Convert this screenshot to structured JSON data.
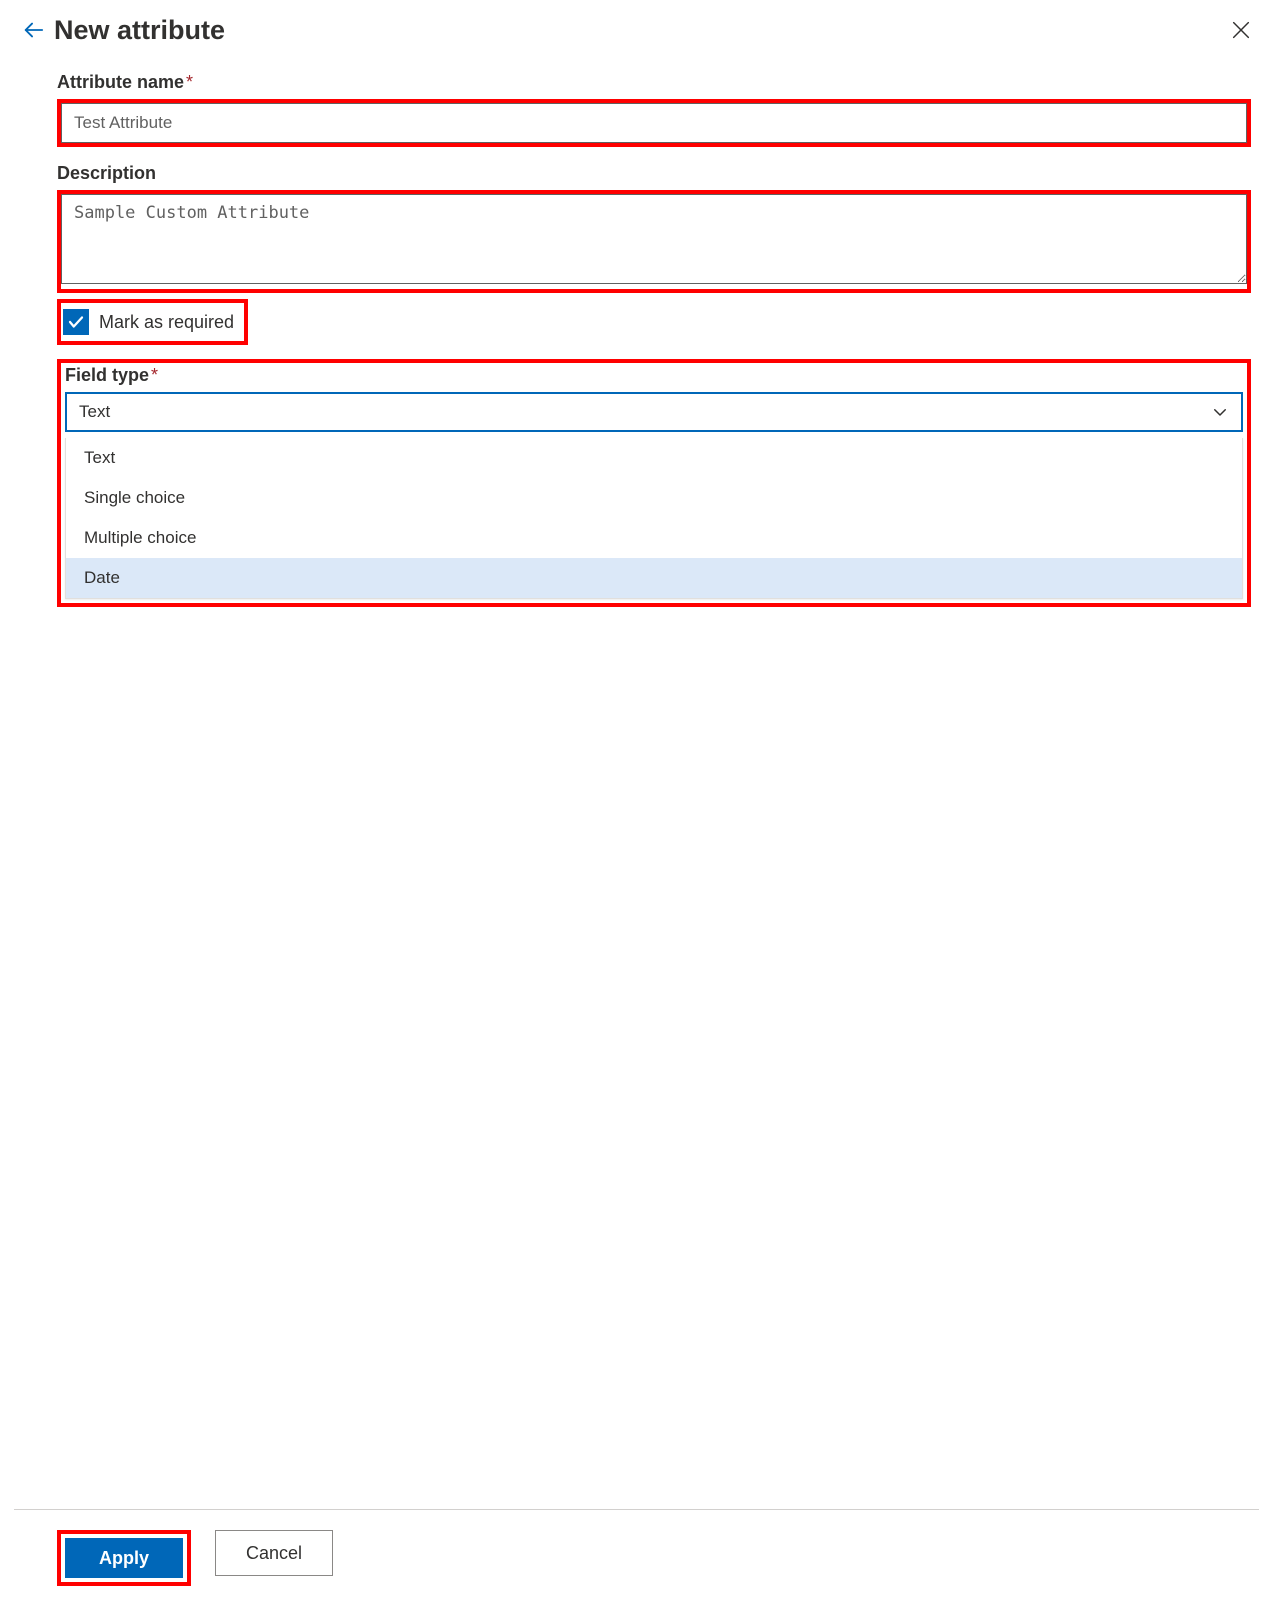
{
  "header": {
    "title": "New attribute"
  },
  "attribute_name": {
    "label": "Attribute name",
    "value": "Test Attribute"
  },
  "description": {
    "label": "Description",
    "value": "Sample Custom Attribute"
  },
  "mark_required": {
    "label": "Mark as required",
    "checked": true
  },
  "field_type": {
    "label": "Field type",
    "selected": "Text",
    "options": [
      "Text",
      "Single choice",
      "Multiple choice",
      "Date"
    ],
    "hovered_option": "Date"
  },
  "buttons": {
    "apply": "Apply",
    "cancel": "Cancel"
  }
}
